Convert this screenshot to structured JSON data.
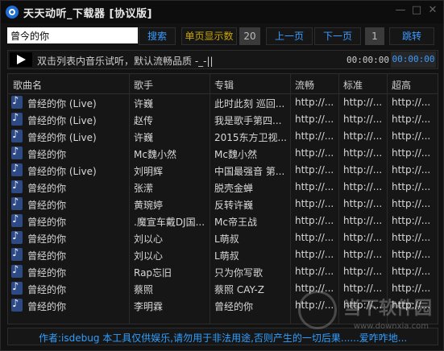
{
  "window": {
    "title": "天天动听_下载器 [协议版]",
    "min": "—",
    "max": "□",
    "close": "✕"
  },
  "search": {
    "value": "曾今的你",
    "button": "搜索"
  },
  "pager": {
    "per_page_label": "单页显示数",
    "per_page": "20",
    "prev": "上一页",
    "next": "下一页",
    "page": "1",
    "jump": "跳转"
  },
  "player": {
    "now_playing": "双击列表内音乐试听，默认流畅品质 -_-||",
    "elapsed": "00:00:00",
    "duration": "00:00:00"
  },
  "table": {
    "headers": [
      "歌曲名",
      "歌手",
      "专辑",
      "流畅",
      "标准",
      "超高"
    ],
    "rows": [
      [
        "曾经的你 (Live)",
        "许巍",
        "此时此刻 巡回...",
        "http://...",
        "http://...",
        "http://..."
      ],
      [
        "曾经的你 (Live)",
        "赵传",
        "我是歌手第四...",
        "http://...",
        "http://...",
        "http://..."
      ],
      [
        "曾经的你 (Live)",
        "许巍",
        "2015东方卫视...",
        "http://...",
        "http://...",
        "http://..."
      ],
      [
        "曾经的你",
        "Mc魏小然",
        "Mc魏小然",
        "http://...",
        "http://...",
        "http://..."
      ],
      [
        "曾经的你 (Live)",
        "刘明辉",
        "中国最强音 第...",
        "http://...",
        "http://...",
        "http://..."
      ],
      [
        "曾经的你",
        "张潆",
        "脱壳金蝉",
        "http://...",
        "http://...",
        "http://..."
      ],
      [
        "曾经的你",
        "黄琬婷",
        "反转许巍",
        "http://...",
        "http://...",
        "http://..."
      ],
      [
        "曾经的你",
        ".魔宣车戴DJ国...",
        "Mc帝王战",
        "http://...",
        "http://...",
        "http://..."
      ],
      [
        "曾经的你",
        "刘以心",
        "L萌叔",
        "http://...",
        "http://...",
        "http://..."
      ],
      [
        "曾经的你",
        "刘以心",
        "L萌叔",
        "http://...",
        "http://...",
        "http://..."
      ],
      [
        "曾经的你",
        "Rap忘旧",
        "只为你写歌",
        "http://...",
        "http://...",
        "http://..."
      ],
      [
        "曾经的你",
        "蔡照",
        "蔡照 CAY-Z",
        "http://...",
        "http://...",
        "http://..."
      ],
      [
        "曾经的你",
        "李明霖",
        "曾经的你",
        "http://...",
        "http://...",
        "http://..."
      ]
    ]
  },
  "footer": {
    "text": "作者:isdebug  本工具仅供娱乐,请勿用于非法用途,否则产生的一切后果......爱咋咋地..."
  },
  "watermark": {
    "brand": "当下软件园",
    "url": "www.downxia.com"
  }
}
